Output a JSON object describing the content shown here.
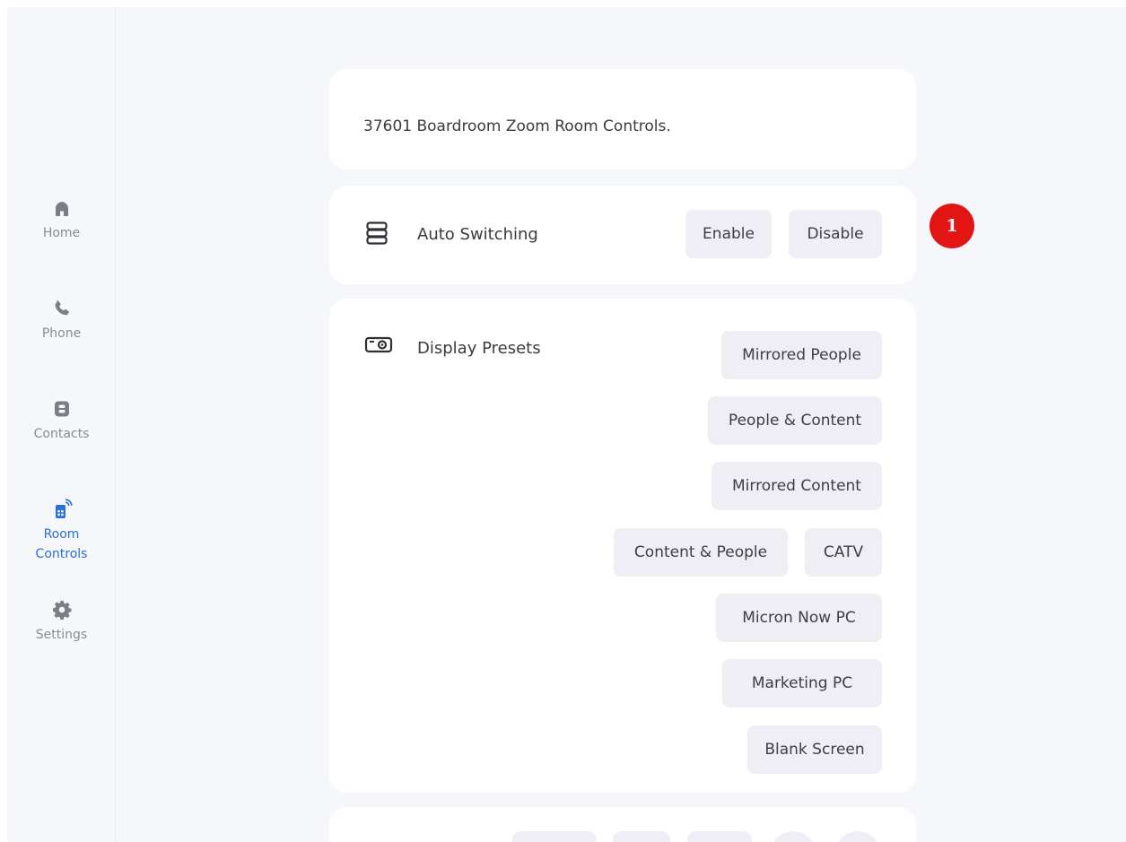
{
  "sidebar": {
    "items": [
      {
        "label": "Home",
        "icon": "home-icon"
      },
      {
        "label": "Phone",
        "icon": "phone-icon"
      },
      {
        "label": "Contacts",
        "icon": "contacts-icon"
      },
      {
        "label": "Room\nControls",
        "icon": "room-controls-icon",
        "active": true
      },
      {
        "label": "Settings",
        "icon": "gear-icon"
      }
    ]
  },
  "header_card": {
    "title": "37601 Boardroom Zoom Room Controls."
  },
  "auto_switching": {
    "label": "Auto Switching",
    "icon": "server-stack-icon",
    "buttons": [
      "Enable",
      "Disable"
    ]
  },
  "display_presets": {
    "label": "Display Presets",
    "icon": "projector-icon",
    "buttons": [
      "Mirrored People",
      "People & Content",
      "Mirrored Content",
      "Content & People",
      "CATV",
      "Micron Now PC",
      "Marketing PC",
      "Blank Screen"
    ]
  },
  "step_badge": "1",
  "colors": {
    "background": "#f6f7fb",
    "card": "#ffffff",
    "button": "#eeeef4",
    "active_nav": "#2b6fd8",
    "badge": "#e31414"
  }
}
